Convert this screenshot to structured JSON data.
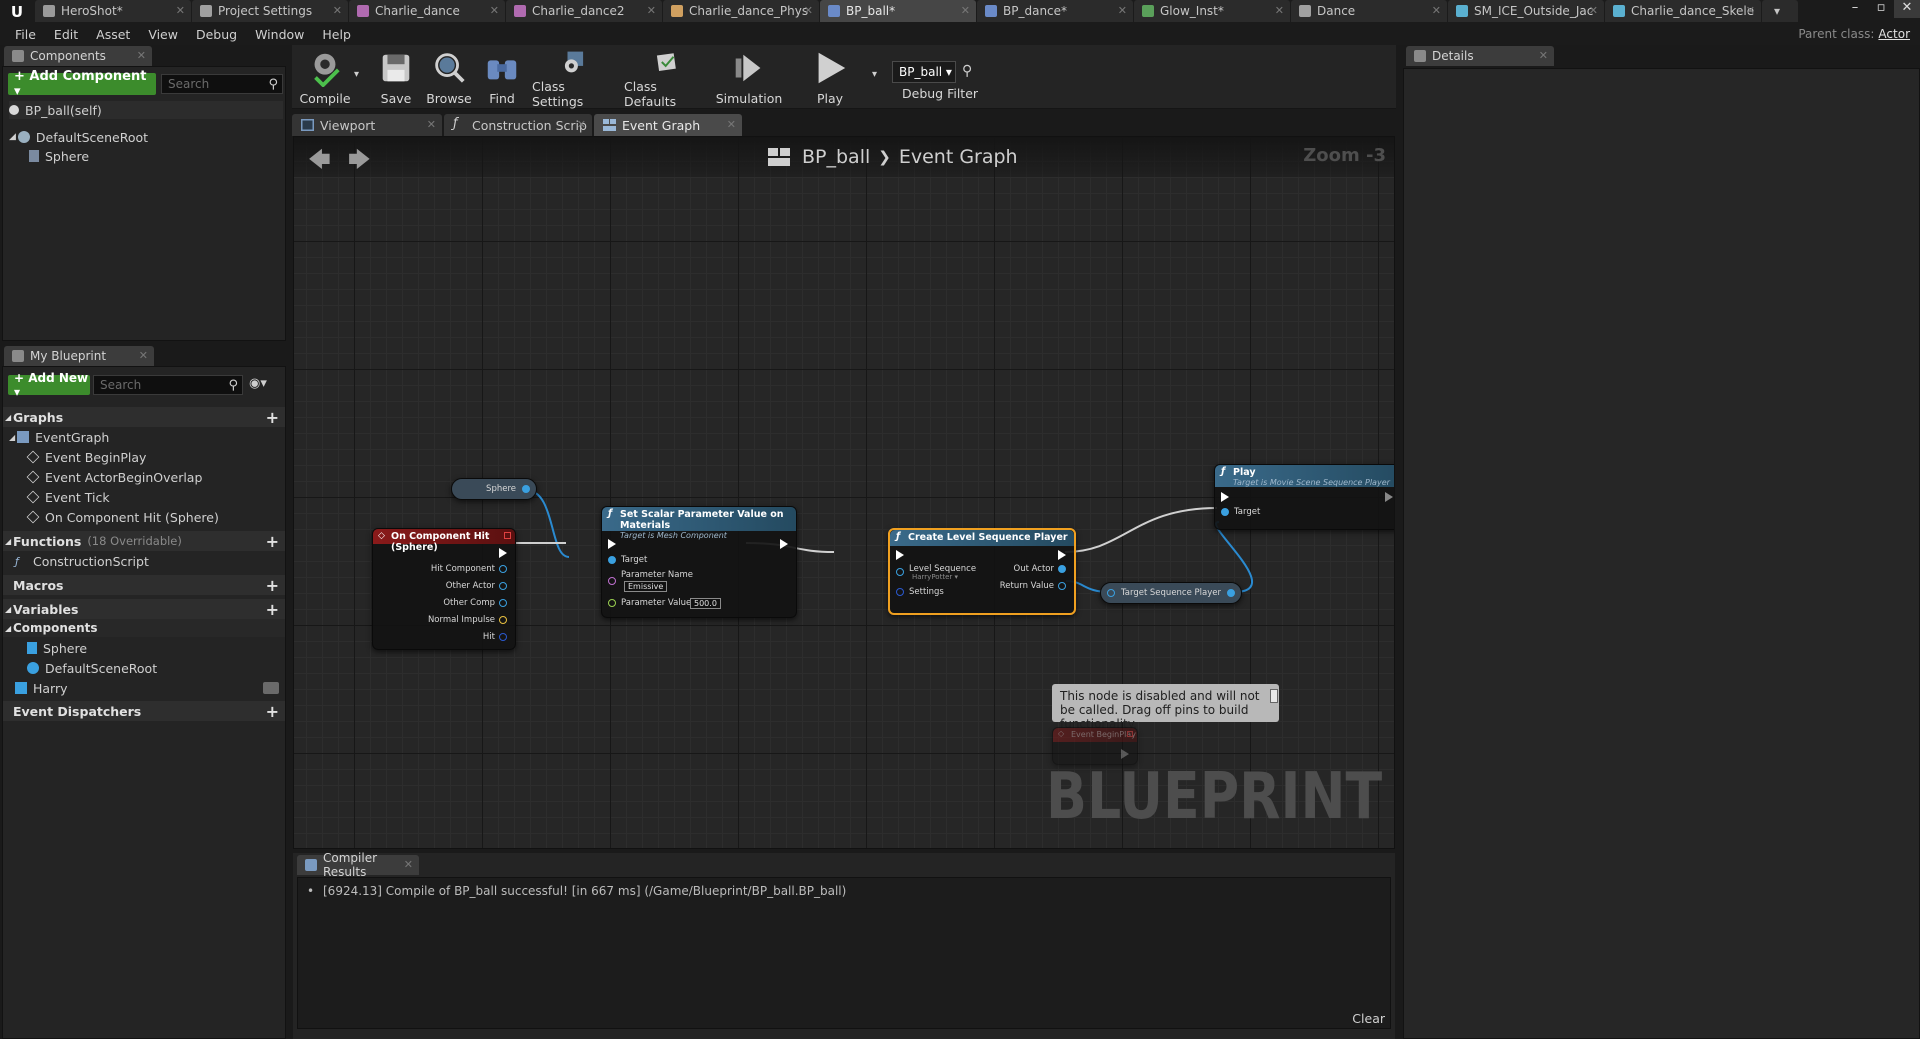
{
  "document_tabs": [
    {
      "label": "HeroShot*",
      "color": "#9a9a9a",
      "active": false
    },
    {
      "label": "Project Settings",
      "color": "#a0a0a0",
      "active": false
    },
    {
      "label": "Charlie_dance",
      "color": "#b06ab0",
      "active": false
    },
    {
      "label": "Charlie_dance2",
      "color": "#b06ab0",
      "active": false
    },
    {
      "label": "Charlie_dance_Phys",
      "color": "#d0a060",
      "active": false
    },
    {
      "label": "BP_ball*",
      "color": "#6a8ac8",
      "active": true
    },
    {
      "label": "BP_dance*",
      "color": "#6a8ac8",
      "active": false
    },
    {
      "label": "Glow_Inst*",
      "color": "#5aa05a",
      "active": false
    },
    {
      "label": "Dance",
      "color": "#a0a0a0",
      "active": false
    },
    {
      "label": "SM_ICE_Outside_Jac",
      "color": "#5ab0d0",
      "active": false
    },
    {
      "label": "Charlie_dance_Skele",
      "color": "#5ab0d0",
      "active": false
    }
  ],
  "menu": [
    "File",
    "Edit",
    "Asset",
    "View",
    "Debug",
    "Window",
    "Help"
  ],
  "parent_class": {
    "label": "Parent class:",
    "value": "Actor"
  },
  "components_panel": {
    "tab_label": "Components",
    "add_button": "+ Add Component ▾",
    "search_placeholder": "Search",
    "self_item": "BP_ball(self)",
    "tree": [
      "DefaultSceneRoot",
      "Sphere"
    ]
  },
  "my_blueprint": {
    "tab_label": "My Blueprint",
    "add_button": "+ Add New ▾",
    "search_placeholder": "Search",
    "graphs_header": "Graphs",
    "event_graph": "EventGraph",
    "events": [
      "Event BeginPlay",
      "Event ActorBeginOverlap",
      "Event Tick",
      "On Component Hit (Sphere)"
    ],
    "functions_header": "Functions",
    "functions_sub": "(18 Overridable)",
    "functions": [
      "ConstructionScript"
    ],
    "macros_header": "Macros",
    "variables_header": "Variables",
    "components_header": "Components",
    "components": [
      "Sphere",
      "DefaultSceneRoot"
    ],
    "variables": [
      "Harry"
    ],
    "dispatchers_header": "Event Dispatchers"
  },
  "toolbar": {
    "buttons": [
      {
        "label": "Compile",
        "icon": "compile-icon"
      },
      {
        "label": "Save",
        "icon": "save-icon"
      },
      {
        "label": "Browse",
        "icon": "browse-icon"
      },
      {
        "label": "Find",
        "icon": "find-icon"
      },
      {
        "label": "Class Settings",
        "icon": "class-settings-icon"
      },
      {
        "label": "Class Defaults",
        "icon": "class-defaults-icon"
      },
      {
        "label": "Simulation",
        "icon": "simulation-icon"
      },
      {
        "label": "Play",
        "icon": "play-icon"
      }
    ],
    "debug_select": "BP_ball ▾",
    "debug_filter_label": "Debug Filter"
  },
  "editor_tabs": [
    {
      "label": "Viewport",
      "active": false
    },
    {
      "label": "Construction Scrip",
      "active": false
    },
    {
      "label": "Event Graph",
      "active": true
    }
  ],
  "graph": {
    "breadcrumb_blueprint": "BP_ball",
    "breadcrumb_graph": "Event Graph",
    "zoom": "Zoom -3",
    "watermark": "BLUEPRINT",
    "nodes": {
      "sphere_getter": {
        "label": "Sphere"
      },
      "on_hit": {
        "title": "On Component Hit (Sphere)",
        "pins": [
          "Hit Component",
          "Other Actor",
          "Other Comp",
          "Normal Impulse",
          "Hit"
        ]
      },
      "set_scalar": {
        "title": "Set Scalar Parameter Value on Materials",
        "subtitle": "Target is Mesh Component",
        "target": "Target",
        "param_name_label": "Parameter Name",
        "param_name_value": "Emissive",
        "param_value_label": "Parameter Value",
        "param_value": "500.0"
      },
      "create_lsp": {
        "title": "Create Level Sequence Player",
        "level_sequence": "Level Sequence",
        "level_sequence_value": "HarryPotter ▾",
        "settings": "Settings",
        "out_actor": "Out Actor",
        "return_value": "Return Value"
      },
      "seq_player": {
        "target": "Target",
        "output": "Sequence Player"
      },
      "play": {
        "title": "Play",
        "subtitle": "Target is Movie Scene Sequence Player",
        "target": "Target"
      },
      "disabled_begin": {
        "title": "Event BeginPlay"
      }
    },
    "disabled_comment": "This node is disabled and will not be called. Drag off pins to build functionality."
  },
  "compiler": {
    "tab_label": "Compiler Results",
    "message": "[6924.13] Compile of BP_ball successful! [in 667 ms] (/Game/Blueprint/BP_ball.BP_ball)",
    "clear": "Clear"
  },
  "details": {
    "tab_label": "Details"
  },
  "colors": {
    "accent_green": "#3c8c2c",
    "event_red": "#8a1a1a",
    "function_blue": "#2a5a7a",
    "selection_orange": "#f0a020",
    "object_pin_blue": "#3aa0e0"
  }
}
